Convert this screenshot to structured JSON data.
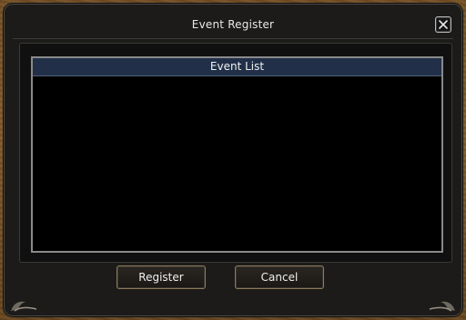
{
  "window": {
    "title": "Event Register"
  },
  "list": {
    "header": "Event List",
    "items": []
  },
  "buttons": {
    "register_label": "Register",
    "cancel_label": "Cancel"
  },
  "colors": {
    "frame": "#1c1b19",
    "wood": "#7a5428",
    "header": "#213048"
  }
}
